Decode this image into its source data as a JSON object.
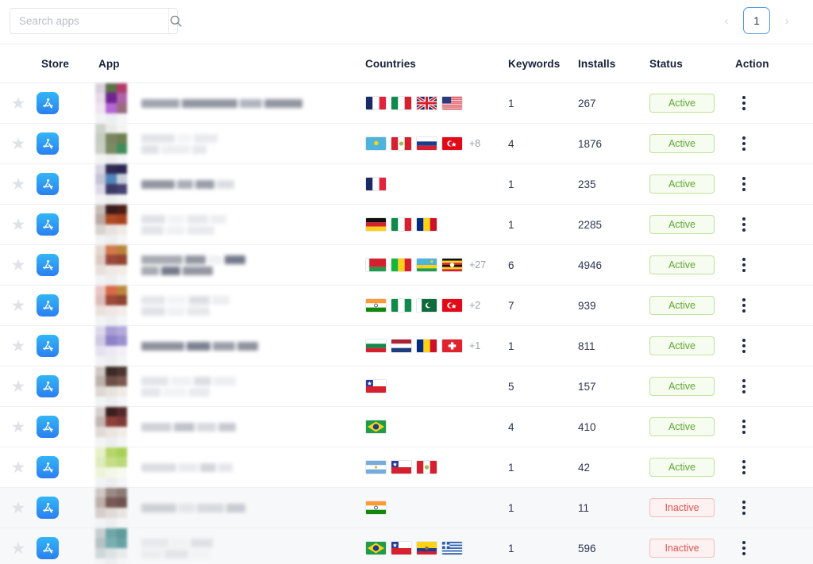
{
  "search": {
    "placeholder": "Search apps",
    "value": "",
    "icon": "search-icon"
  },
  "pagination": {
    "prev_label": "‹",
    "next_label": "›",
    "current_page": "1"
  },
  "table": {
    "columns": [
      {
        "key": "star",
        "label": ""
      },
      {
        "key": "store",
        "label": "Store"
      },
      {
        "key": "app",
        "label": "App"
      },
      {
        "key": "countries",
        "label": "Countries"
      },
      {
        "key": "keywords",
        "label": "Keywords"
      },
      {
        "key": "installs",
        "label": "Installs"
      },
      {
        "key": "status",
        "label": "Status"
      },
      {
        "key": "action",
        "label": "Action"
      }
    ],
    "rows": [
      {
        "store": "app-store",
        "app_name_redacted": true,
        "countries": [
          "FR",
          "IT",
          "GB",
          "US"
        ],
        "extra_countries": "",
        "keywords": "1",
        "installs": "267",
        "status": "Active",
        "highlight": false
      },
      {
        "store": "app-store",
        "app_name_redacted": true,
        "countries": [
          "KZ",
          "PE",
          "RU",
          "TR"
        ],
        "extra_countries": "+8",
        "keywords": "4",
        "installs": "1876",
        "status": "Active",
        "highlight": false
      },
      {
        "store": "app-store",
        "app_name_redacted": true,
        "countries": [
          "FR"
        ],
        "extra_countries": "",
        "keywords": "1",
        "installs": "235",
        "status": "Active",
        "highlight": false
      },
      {
        "store": "app-store",
        "app_name_redacted": true,
        "countries": [
          "DE",
          "IT",
          "RO"
        ],
        "extra_countries": "",
        "keywords": "1",
        "installs": "2285",
        "status": "Active",
        "highlight": false
      },
      {
        "store": "app-store",
        "app_name_redacted": true,
        "countries": [
          "BY",
          "ML",
          "RW",
          "UG"
        ],
        "extra_countries": "+27",
        "keywords": "6",
        "installs": "4946",
        "status": "Active",
        "highlight": false
      },
      {
        "store": "app-store",
        "app_name_redacted": true,
        "countries": [
          "IN",
          "NG",
          "PK",
          "TR"
        ],
        "extra_countries": "+2",
        "keywords": "7",
        "installs": "939",
        "status": "Active",
        "highlight": false
      },
      {
        "store": "app-store",
        "app_name_redacted": true,
        "countries": [
          "BG",
          "NL",
          "RO",
          "CH"
        ],
        "extra_countries": "+1",
        "keywords": "1",
        "installs": "811",
        "status": "Active",
        "highlight": false
      },
      {
        "store": "app-store",
        "app_name_redacted": true,
        "countries": [
          "CL"
        ],
        "extra_countries": "",
        "keywords": "5",
        "installs": "157",
        "status": "Active",
        "highlight": false
      },
      {
        "store": "app-store",
        "app_name_redacted": true,
        "countries": [
          "BR"
        ],
        "extra_countries": "",
        "keywords": "4",
        "installs": "410",
        "status": "Active",
        "highlight": false
      },
      {
        "store": "app-store",
        "app_name_redacted": true,
        "countries": [
          "AR",
          "CL",
          "PE"
        ],
        "extra_countries": "",
        "keywords": "1",
        "installs": "42",
        "status": "Active",
        "highlight": false
      },
      {
        "store": "app-store",
        "app_name_redacted": true,
        "countries": [
          "IN"
        ],
        "extra_countries": "",
        "keywords": "1",
        "installs": "11",
        "status": "Inactive",
        "highlight": true
      },
      {
        "store": "app-store",
        "app_name_redacted": true,
        "countries": [
          "BR",
          "CL",
          "EC",
          "GR"
        ],
        "extra_countries": "",
        "keywords": "1",
        "installs": "596",
        "status": "Inactive",
        "highlight": true
      }
    ]
  },
  "colors": {
    "accent_blue": "#4a9ae8",
    "status_active_text": "#5ea832",
    "status_active_border": "#bfe39b",
    "status_active_bg": "#f6fcef",
    "status_inactive_text": "#e0534f",
    "status_inactive_border": "#f4bdbb",
    "status_inactive_bg": "#fdf2f1",
    "row_highlight_bg": "#f7f8f9",
    "text_primary": "#1f2b46",
    "star_icon": "#dfe3e8"
  },
  "redaction": {
    "icon_palettes": [
      [
        "#d9cfdb",
        "#5c7049",
        "#b23a66",
        "#e6dae8",
        "#6f2391",
        "#ab62a8",
        "#efe4f0",
        "#b567d6",
        "#9a6b7d"
      ],
      [
        "#cdd3c9",
        "#e9eae7",
        "#f3f4f2",
        "#c4ccc0",
        "#7a8560",
        "#6f7f50",
        "#c8cfc4",
        "#7b8a63",
        "#3e8c5a"
      ],
      [
        "#d8d5e2",
        "#2e2a52",
        "#2a2550",
        "#c3c2d6",
        "#4f85bb",
        "#c8cfdc",
        "#dcd9e6",
        "#3e3a68",
        "#474170"
      ],
      [
        "#c8bdb6",
        "#3a1a1c",
        "#4a1d18",
        "#b9aaa3",
        "#b04a24",
        "#a8411f",
        "#d9d2cd",
        "#e8e2de",
        "#efeae6"
      ],
      [
        "#e3d6cf",
        "#d27a4c",
        "#b8833a",
        "#ddcbc2",
        "#9a4a3c",
        "#93432f",
        "#e8e0dc",
        "#efe8e4",
        "#f2ece8"
      ],
      [
        "#e9c6c4",
        "#d86a48",
        "#b9873c",
        "#ddbdb9",
        "#9e4a3b",
        "#8d4430",
        "#ece0dd",
        "#f0e6e3",
        "#f3eceb"
      ],
      [
        "#dcd8ea",
        "#a79ed4",
        "#b3a9dd",
        "#cfc9e2",
        "#8d82c7",
        "#9a90cf",
        "#e5e1ef",
        "#ece9f4",
        "#f2f0f7"
      ],
      [
        "#cfc7c2",
        "#3b2b28",
        "#4a3531",
        "#bdb2ac",
        "#6d4f47",
        "#7a584f",
        "#ded7d2",
        "#e8e2dd",
        "#efeae6"
      ],
      [
        "#d6cfcc",
        "#3a1f20",
        "#55282a",
        "#c3b6b2",
        "#8e3f3a",
        "#7d3a34",
        "#e1d9d6",
        "#ebe4e1",
        "#f1ecea"
      ],
      [
        "#e6f0c9",
        "#b5d66a",
        "#a8cf57",
        "#dfeabd",
        "#c4dd86",
        "#bad97a",
        "#eef4da",
        "#f3f7e7",
        "#f7faf0"
      ],
      [
        "#cfc7c4",
        "#9a8a85",
        "#8b7a76",
        "#bdb0ac",
        "#7a5a55",
        "#6f534e",
        "#d6cecb",
        "#e0dad7",
        "#e9e4e2"
      ],
      [
        "#c6ced0",
        "#6fa6a8",
        "#5f9a9d",
        "#b6c2c4",
        "#79aeb0",
        "#68a2a5",
        "#cfd8d9",
        "#dde3e4",
        "#e7ebec"
      ]
    ],
    "name_bar_rows": [
      [
        [
          48,
          "#a0a4ad"
        ],
        [
          70,
          "#9296a1"
        ],
        [
          28,
          "#b0b4bc"
        ],
        [
          48,
          "#9296a1"
        ]
      ],
      [
        [
          42,
          "#e2e4e8"
        ],
        [
          18,
          "#f3f4f6"
        ],
        [
          30,
          "#e8eaee"
        ],
        [
          22,
          "#e0e2e7"
        ],
        [
          36,
          "#edeef1"
        ],
        [
          18,
          "#e6e8ec"
        ]
      ],
      [
        [
          42,
          "#9296a1"
        ],
        [
          20,
          "#a8acb4"
        ],
        [
          24,
          "#9a9ea8"
        ],
        [
          22,
          "#dcdee3"
        ]
      ],
      [
        [
          30,
          "#e0e2e7"
        ],
        [
          22,
          "#f2f3f5"
        ],
        [
          26,
          "#e6e8ec"
        ],
        [
          20,
          "#eceef1"
        ],
        [
          28,
          "#e2e4e8"
        ],
        [
          24,
          "#f0f1f3"
        ],
        [
          34,
          "#e8eaee"
        ]
      ],
      [
        [
          52,
          "#a6aab2"
        ],
        [
          26,
          "#9296a1"
        ],
        [
          18,
          "#f0f1f3"
        ],
        [
          26,
          "#74798a"
        ],
        [
          22,
          "#a6aab2"
        ],
        [
          24,
          "#74798a"
        ],
        [
          38,
          "#9296a1"
        ]
      ],
      [
        [
          30,
          "#e4e6ea"
        ],
        [
          24,
          "#f3f4f6"
        ],
        [
          26,
          "#dcdee3"
        ],
        [
          22,
          "#eceef1"
        ],
        [
          30,
          "#e0e2e7"
        ],
        [
          22,
          "#f0f1f3"
        ],
        [
          28,
          "#e6e8ec"
        ]
      ],
      [
        [
          54,
          "#8e929d"
        ],
        [
          30,
          "#7c8190"
        ],
        [
          28,
          "#9a9ea8"
        ],
        [
          26,
          "#8e929d"
        ]
      ],
      [
        [
          34,
          "#e2e4e8"
        ],
        [
          26,
          "#f0f1f3"
        ],
        [
          22,
          "#dcdee3"
        ],
        [
          28,
          "#eceef1"
        ],
        [
          24,
          "#e4e6ea"
        ],
        [
          30,
          "#f2f3f5"
        ],
        [
          26,
          "#e8eaee"
        ]
      ],
      [
        [
          38,
          "#cfd2d8"
        ],
        [
          26,
          "#bfc3ca"
        ],
        [
          24,
          "#d6d9de"
        ],
        [
          22,
          "#c7cad1"
        ]
      ],
      [
        [
          44,
          "#dbdde2"
        ],
        [
          24,
          "#e8eaee"
        ],
        [
          20,
          "#d2d5db"
        ],
        [
          18,
          "#e4e6ea"
        ]
      ],
      [
        [
          44,
          "#cdd0d6"
        ],
        [
          20,
          "#e2e4e8"
        ],
        [
          34,
          "#d6d9de"
        ],
        [
          24,
          "#c8cbd2"
        ]
      ],
      [
        [
          34,
          "#e6e8ec"
        ],
        [
          22,
          "#f0f1f3"
        ],
        [
          28,
          "#dee0e5"
        ],
        [
          26,
          "#eaecef"
        ],
        [
          30,
          "#e2e4e8"
        ],
        [
          24,
          "#f2f3f5"
        ]
      ]
    ]
  }
}
